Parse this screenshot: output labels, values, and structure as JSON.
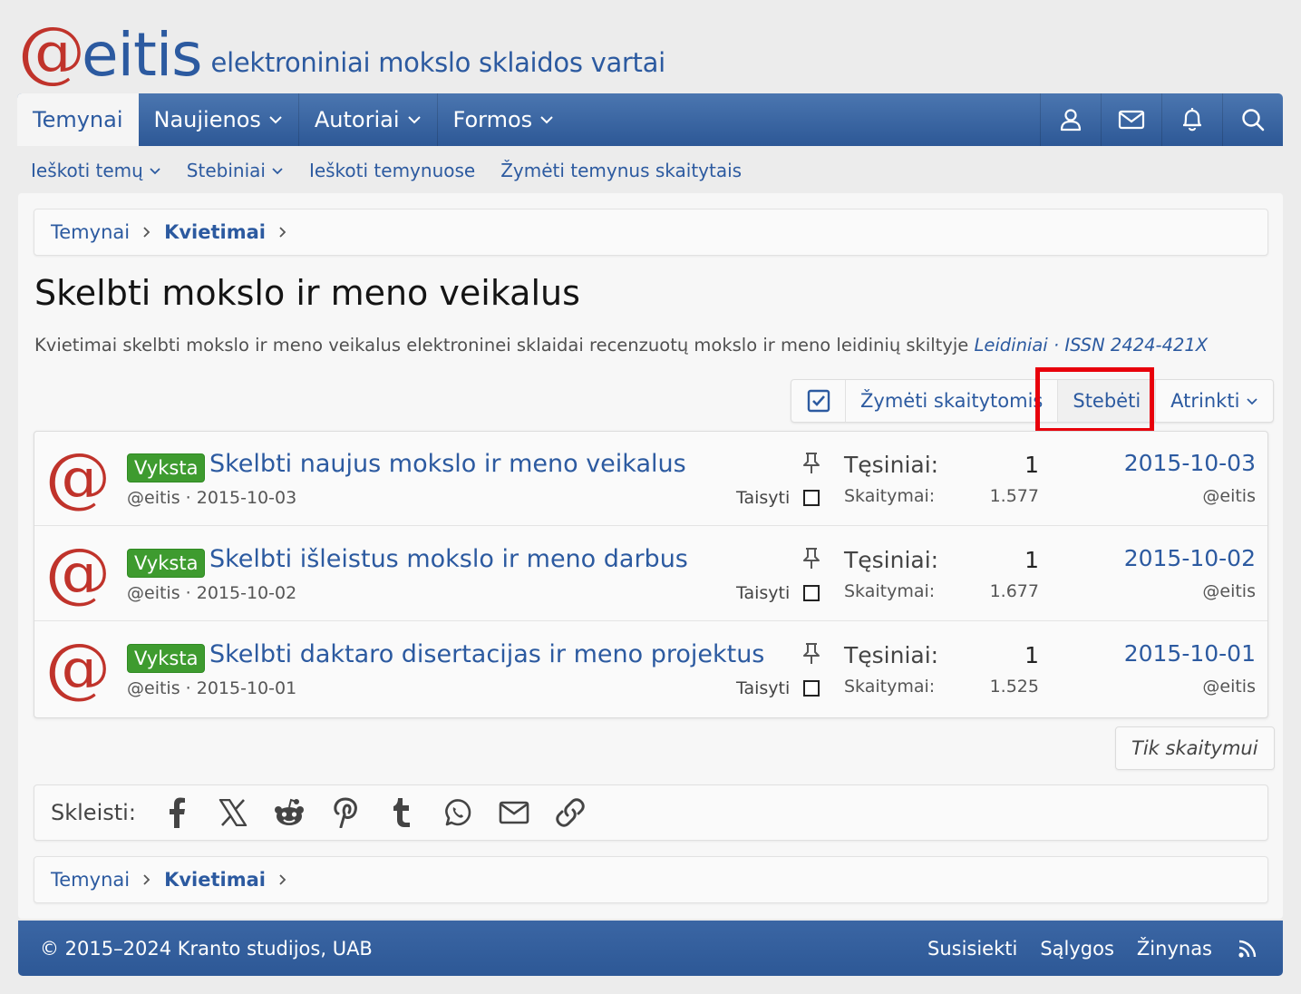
{
  "header": {
    "logo_at": "@",
    "logo_word": "eitis",
    "tagline": "elektroniniai mokslo sklaidos vartai"
  },
  "nav": {
    "tabs": [
      {
        "label": "Temynai",
        "active": true,
        "dropdown": false
      },
      {
        "label": "Naujienos",
        "active": false,
        "dropdown": true
      },
      {
        "label": "Autoriai",
        "active": false,
        "dropdown": true
      },
      {
        "label": "Formos",
        "active": false,
        "dropdown": true
      }
    ],
    "icons": [
      "user-icon",
      "envelope-icon",
      "bell-icon",
      "search-icon"
    ]
  },
  "subnav": {
    "items": [
      {
        "label": "Ieškoti temų",
        "dropdown": true
      },
      {
        "label": "Stebiniai",
        "dropdown": true
      },
      {
        "label": "Ieškoti temynuose",
        "dropdown": false
      },
      {
        "label": "Žymėti temynus skaitytais",
        "dropdown": false
      }
    ]
  },
  "breadcrumb": {
    "items": [
      "Temynai",
      "Kvietimai"
    ]
  },
  "page": {
    "title": "Skelbti mokslo ir meno veikalus",
    "description": "Kvietimai skelbti mokslo ir meno veikalus elektroninei sklaidai recenzuotų mokslo ir meno leidinių skiltyje",
    "description_link": "Leidiniai · ISSN 2424-421X"
  },
  "actions": {
    "mark_read": "Žymėti skaitytomis",
    "watch": "Stebėti",
    "filter": "Atrinkti"
  },
  "threads": [
    {
      "prefix": "Vyksta",
      "title": "Skelbti naujus mokslo ir meno veikalus",
      "author": "@eitis",
      "date": "2015-10-03",
      "edit": "Taisyti",
      "replies_label": "Tęsiniai:",
      "replies": "1",
      "views_label": "Skaitymai:",
      "views": "1.577",
      "last_date": "2015-10-03",
      "last_user": "@eitis"
    },
    {
      "prefix": "Vyksta",
      "title": "Skelbti išleistus mokslo ir meno darbus",
      "author": "@eitis",
      "date": "2015-10-02",
      "edit": "Taisyti",
      "replies_label": "Tęsiniai:",
      "replies": "1",
      "views_label": "Skaitymai:",
      "views": "1.677",
      "last_date": "2015-10-02",
      "last_user": "@eitis"
    },
    {
      "prefix": "Vyksta",
      "title": "Skelbti daktaro disertacijas ir meno projektus",
      "author": "@eitis",
      "date": "2015-10-01",
      "edit": "Taisyti",
      "replies_label": "Tęsiniai:",
      "replies": "1",
      "views_label": "Skaitymai:",
      "views": "1.525",
      "last_date": "2015-10-01",
      "last_user": "@eitis"
    }
  ],
  "readonly_label": "Tik skaitymui",
  "share": {
    "label": "Skleisti:",
    "icons": [
      "facebook-icon",
      "x-icon",
      "reddit-icon",
      "pinterest-icon",
      "tumblr-icon",
      "whatsapp-icon",
      "email-icon",
      "link-icon"
    ]
  },
  "footer": {
    "copyright": "© 2015–2024 Kranto studijos, UAB",
    "links": [
      "Susisiekti",
      "Sąlygos",
      "Žinynas"
    ]
  },
  "colors": {
    "brand_blue": "#2c5aa0",
    "brand_red": "#c0332b",
    "badge_green": "#3e9b2f",
    "highlight_red": "#e8000b"
  }
}
